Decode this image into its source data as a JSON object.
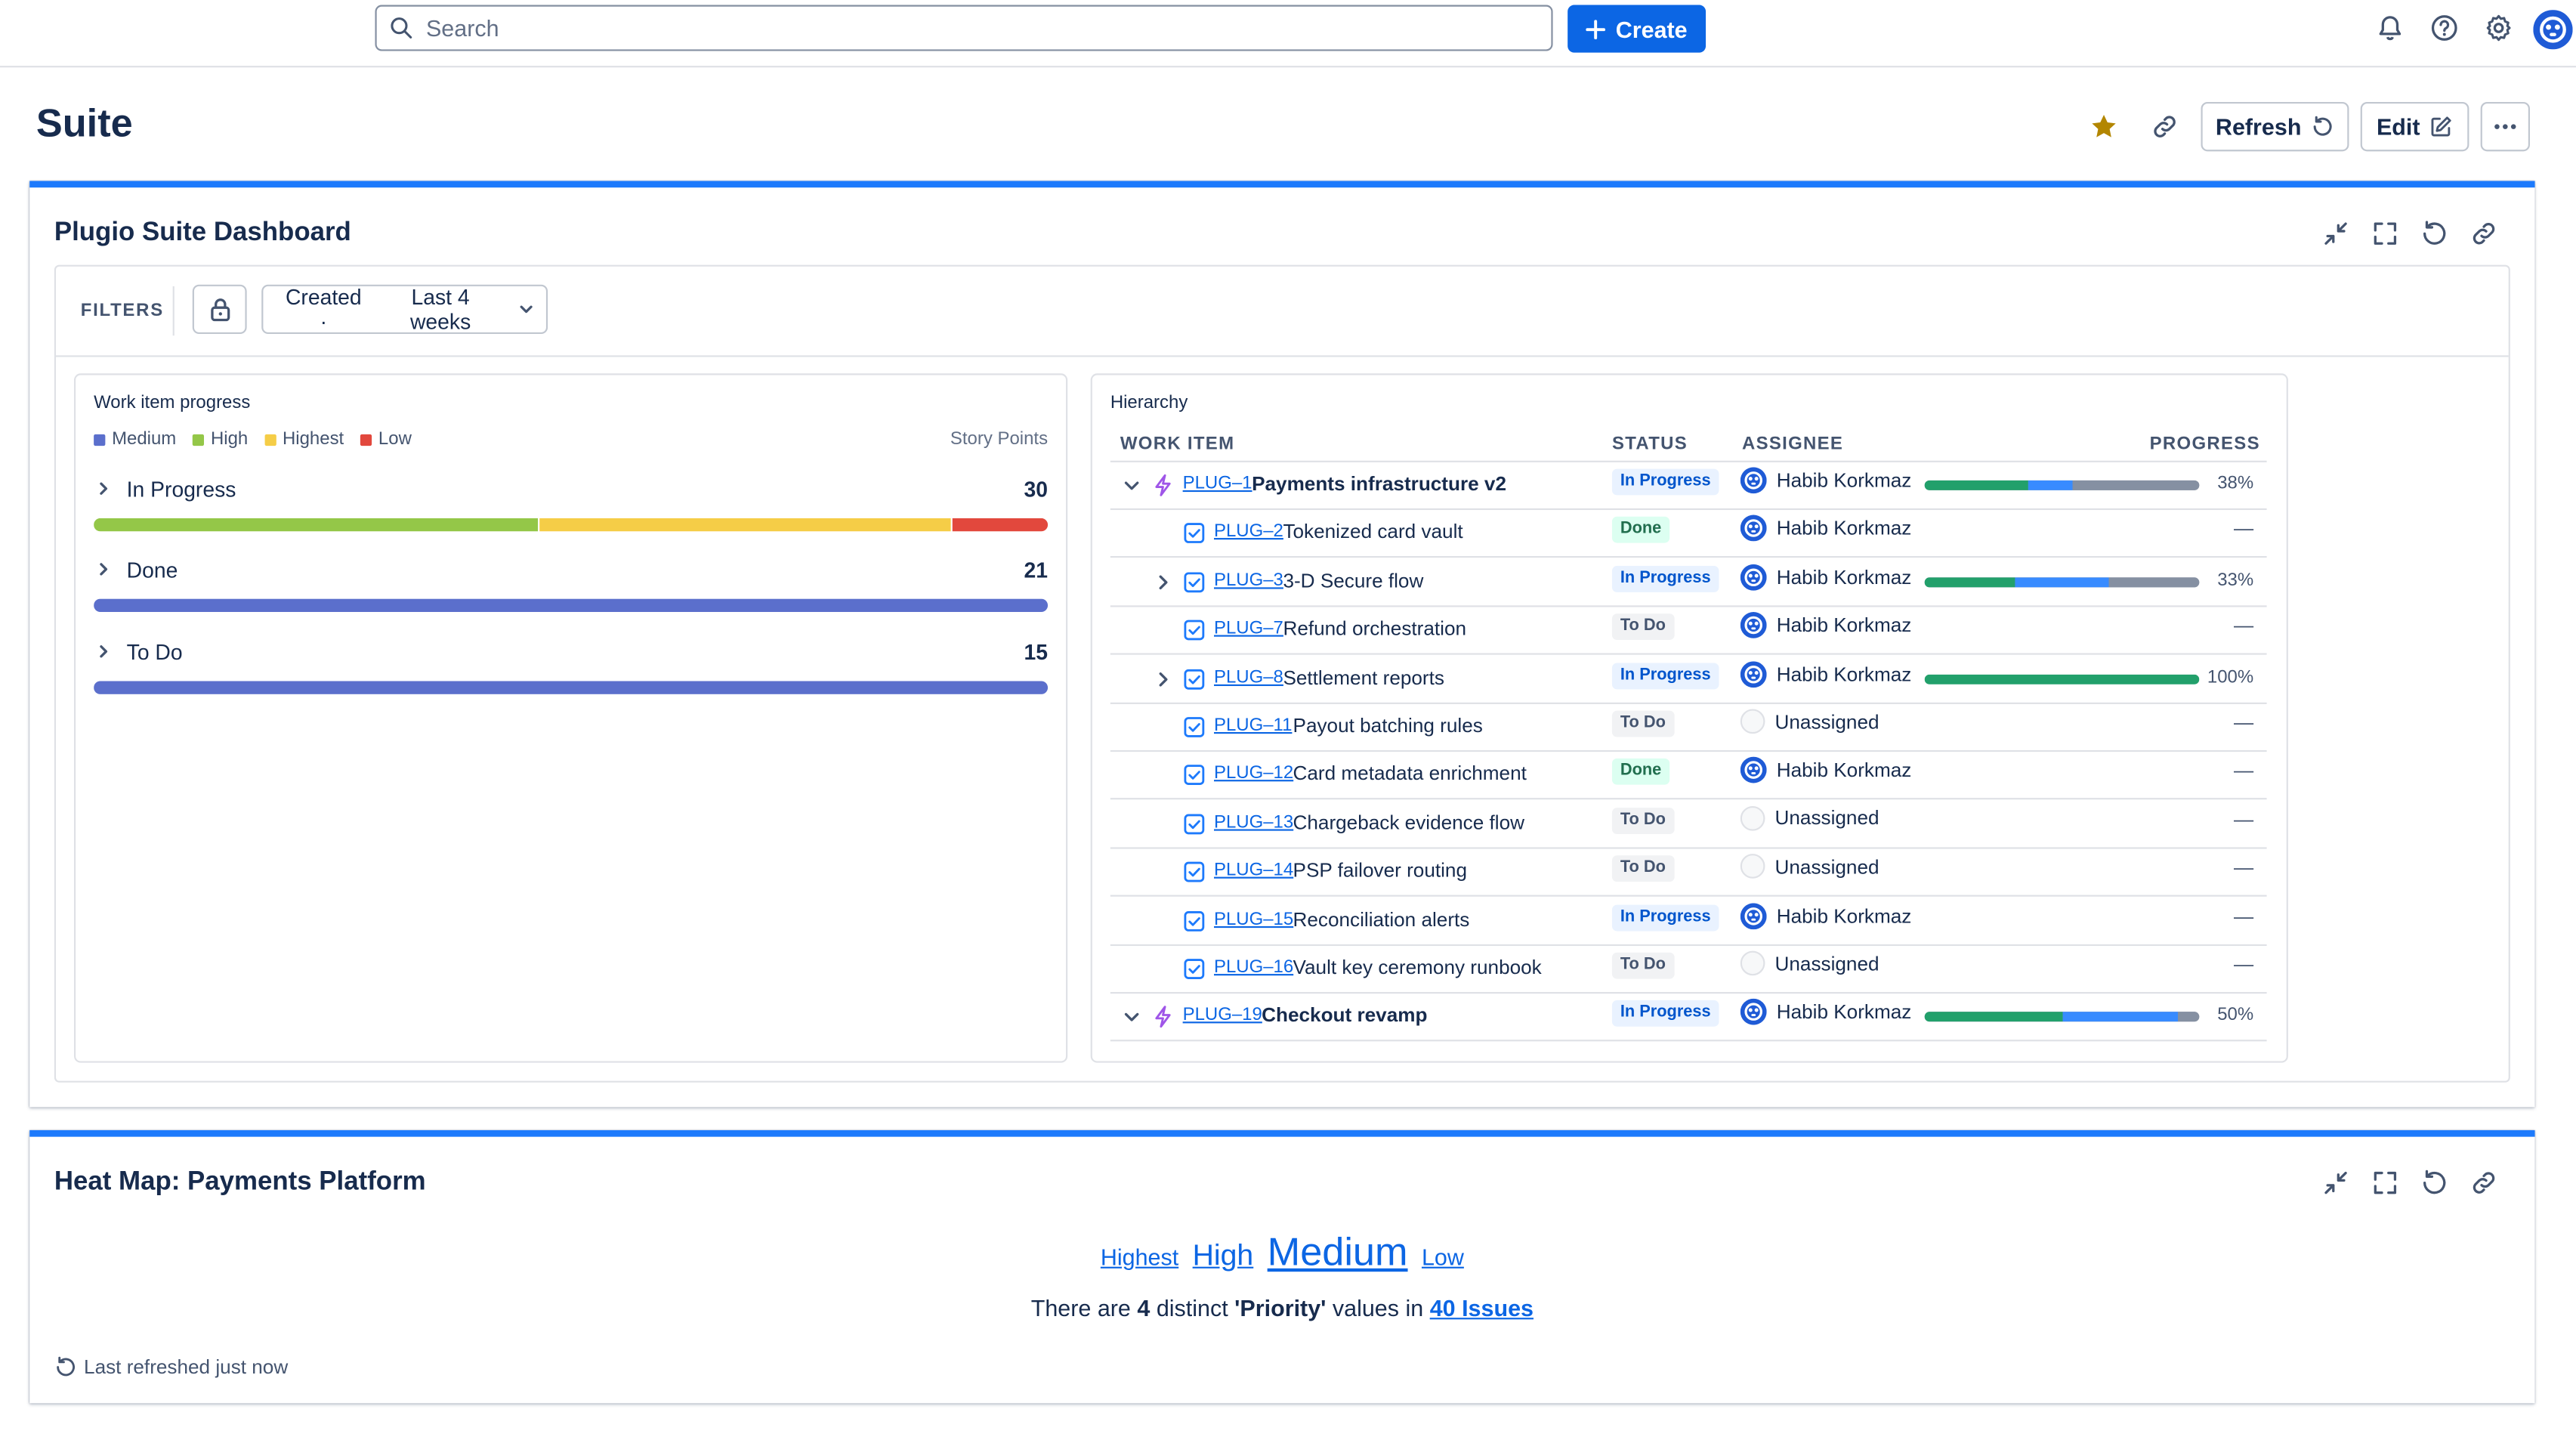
{
  "topbar": {
    "search_placeholder": "Search",
    "create_label": "Create"
  },
  "page": {
    "title": "Suite",
    "refresh_label": "Refresh",
    "edit_label": "Edit"
  },
  "dashboard_gadget": {
    "title": "Plugio Suite Dashboard",
    "filters_label": "FILTERS",
    "created_label": "Created ·",
    "created_value": "Last 4 weeks"
  },
  "progress": {
    "title": "Work item progress",
    "legend": [
      {
        "label": "Medium",
        "color": "#5b6fcc"
      },
      {
        "label": "High",
        "color": "#94c748"
      },
      {
        "label": "Highest",
        "color": "#f5cd47"
      },
      {
        "label": "Low",
        "color": "#e2483d"
      }
    ],
    "unit_label": "Story Points",
    "rows": [
      {
        "name": "In Progress",
        "value": "30",
        "segments": [
          {
            "fraction": 0.467,
            "color": "#94c748"
          },
          {
            "fraction": 0.433,
            "color": "#f5cd47"
          },
          {
            "fraction": 0.1,
            "color": "#e2483d"
          }
        ]
      },
      {
        "name": "Done",
        "value": "21",
        "segments": [
          {
            "fraction": 1.0,
            "color": "#5b6fcc"
          }
        ]
      },
      {
        "name": "To Do",
        "value": "15",
        "segments": [
          {
            "fraction": 1.0,
            "color": "#5b6fcc"
          }
        ]
      }
    ]
  },
  "hierarchy": {
    "title": "Hierarchy",
    "columns": {
      "work_item": "WORK ITEM",
      "status": "STATUS",
      "assignee": "ASSIGNEE",
      "progress": "PROGRESS"
    },
    "rows": [
      {
        "level": 0,
        "chevron": "down",
        "type": "epic",
        "key": "PLUG–1",
        "summary": "Payments infrastructure v2",
        "status": "In Progress",
        "assignee": "Habib Korkmaz",
        "progress": {
          "percent": "38%",
          "segments": [
            {
              "fraction": 0.38,
              "color": "#22a06b"
            },
            {
              "fraction": 0.16,
              "color": "#388bff"
            },
            {
              "fraction": 0.46,
              "color": "#8590a2"
            }
          ]
        }
      },
      {
        "level": 1,
        "chevron": "",
        "type": "task",
        "key": "PLUG–2",
        "summary": "Tokenized card vault",
        "status": "Done",
        "assignee": "Habib Korkmaz",
        "progress": null
      },
      {
        "level": 1,
        "chevron": "right",
        "type": "task",
        "key": "PLUG–3",
        "summary": "3-D Secure flow",
        "status": "In Progress",
        "assignee": "Habib Korkmaz",
        "progress": {
          "percent": "33%",
          "segments": [
            {
              "fraction": 0.33,
              "color": "#22a06b"
            },
            {
              "fraction": 0.34,
              "color": "#388bff"
            },
            {
              "fraction": 0.33,
              "color": "#8590a2"
            }
          ]
        }
      },
      {
        "level": 1,
        "chevron": "",
        "type": "task",
        "key": "PLUG–7",
        "summary": "Refund orchestration",
        "status": "To Do",
        "assignee": "Habib Korkmaz",
        "progress": null
      },
      {
        "level": 1,
        "chevron": "right",
        "type": "task",
        "key": "PLUG–8",
        "summary": "Settlement reports",
        "status": "In Progress",
        "assignee": "Habib Korkmaz",
        "progress": {
          "percent": "100%",
          "segments": [
            {
              "fraction": 1.0,
              "color": "#22a06b"
            }
          ]
        }
      },
      {
        "level": 1,
        "chevron": "",
        "type": "task",
        "key": "PLUG–11",
        "summary": "Payout batching rules",
        "status": "To Do",
        "assignee": "Unassigned",
        "progress": null
      },
      {
        "level": 1,
        "chevron": "",
        "type": "task",
        "key": "PLUG–12",
        "summary": "Card metadata enrichment",
        "status": "Done",
        "assignee": "Habib Korkmaz",
        "progress": null
      },
      {
        "level": 1,
        "chevron": "",
        "type": "task",
        "key": "PLUG–13",
        "summary": "Chargeback evidence flow",
        "status": "To Do",
        "assignee": "Unassigned",
        "progress": null
      },
      {
        "level": 1,
        "chevron": "",
        "type": "task",
        "key": "PLUG–14",
        "summary": "PSP failover routing",
        "status": "To Do",
        "assignee": "Unassigned",
        "progress": null
      },
      {
        "level": 1,
        "chevron": "",
        "type": "task",
        "key": "PLUG–15",
        "summary": "Reconciliation alerts",
        "status": "In Progress",
        "assignee": "Habib Korkmaz",
        "progress": null
      },
      {
        "level": 1,
        "chevron": "",
        "type": "task",
        "key": "PLUG–16",
        "summary": "Vault key ceremony runbook",
        "status": "To Do",
        "assignee": "Unassigned",
        "progress": null
      },
      {
        "level": 0,
        "chevron": "down",
        "type": "epic",
        "key": "PLUG–19",
        "summary": "Checkout revamp",
        "status": "In Progress",
        "assignee": "Habib Korkmaz",
        "progress": {
          "percent": "50%",
          "segments": [
            {
              "fraction": 0.5,
              "color": "#22a06b"
            },
            {
              "fraction": 0.42,
              "color": "#388bff"
            },
            {
              "fraction": 0.08,
              "color": "#8590a2"
            }
          ]
        }
      }
    ],
    "empty_progress": "—"
  },
  "heatmap": {
    "title": "Heat Map: Payments Platform",
    "tags": [
      {
        "label": "Highest",
        "size": 14
      },
      {
        "label": "High",
        "size": 18
      },
      {
        "label": "Medium",
        "size": 24
      },
      {
        "label": "Low",
        "size": 14
      }
    ],
    "text_prefix": "There are ",
    "count": "4",
    "text_mid": " distinct ",
    "field": "'Priority'",
    "text_suffix": " values in ",
    "issues_link": "40 Issues",
    "refreshed": "Last refreshed just now"
  },
  "colors": {
    "accent": "#1d7afc",
    "primary_button": "#0c66e4",
    "star": "#b38600"
  }
}
